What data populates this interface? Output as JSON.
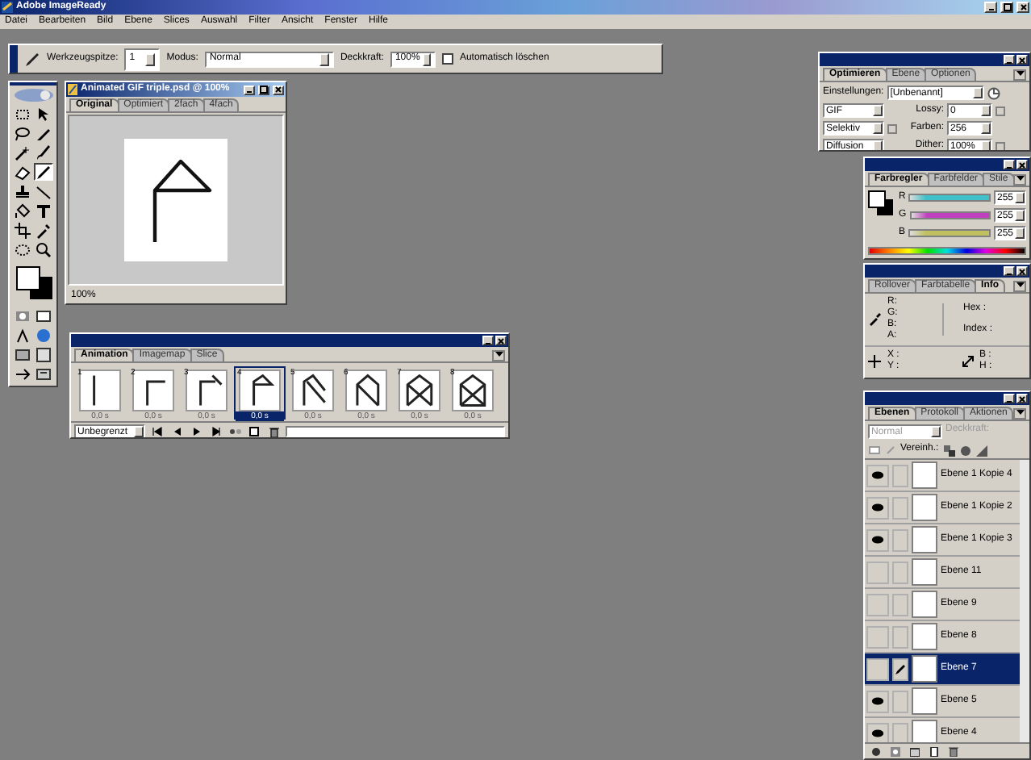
{
  "window": {
    "title": "Adobe ImageReady"
  },
  "menu": [
    "Datei",
    "Bearbeiten",
    "Bild",
    "Ebene",
    "Slices",
    "Auswahl",
    "Filter",
    "Ansicht",
    "Fenster",
    "Hilfe"
  ],
  "options_bar": {
    "brush_label": "Werkzeugspitze:",
    "brush_size": "1",
    "mode_label": "Modus:",
    "mode": "Normal",
    "opacity_label": "Deckkraft:",
    "opacity": "100%",
    "auto_erase": {
      "label": "Automatisch löschen",
      "checked": false
    }
  },
  "tools": [
    {
      "kind": "marquee",
      "selected": false
    },
    {
      "kind": "move",
      "selected": false
    },
    {
      "kind": "lasso",
      "selected": false
    },
    {
      "kind": "slice",
      "selected": false
    },
    {
      "kind": "wand",
      "selected": false
    },
    {
      "kind": "brush",
      "selected": false
    },
    {
      "kind": "eraser",
      "selected": false
    },
    {
      "kind": "pencil",
      "selected": true
    },
    {
      "kind": "stamp",
      "selected": false
    },
    {
      "kind": "line",
      "selected": false
    },
    {
      "kind": "bucket",
      "selected": false
    },
    {
      "kind": "type",
      "selected": false
    },
    {
      "kind": "crop",
      "selected": false
    },
    {
      "kind": "dropper",
      "selected": false
    },
    {
      "kind": "ellipse",
      "selected": false
    },
    {
      "kind": "zoom",
      "selected": false
    }
  ],
  "document": {
    "title": "Animated GIF triple.psd @ 100%",
    "tabs": [
      {
        "label": "Original",
        "selected": true
      },
      {
        "label": "Optimiert",
        "selected": false
      },
      {
        "label": "2fach",
        "selected": false
      },
      {
        "label": "4fach",
        "selected": false
      }
    ],
    "zoom": "100%"
  },
  "animation": {
    "tabs": [
      {
        "label": "Animation",
        "selected": true
      },
      {
        "label": "Imagemap",
        "selected": false
      },
      {
        "label": "Slice",
        "selected": false
      }
    ],
    "frames": [
      {
        "number": "1",
        "delay": "0,0 s",
        "selected": false
      },
      {
        "number": "2",
        "delay": "0,0 s",
        "selected": false
      },
      {
        "number": "3",
        "delay": "0,0 s",
        "selected": false
      },
      {
        "number": "4",
        "delay": "0,0 s",
        "selected": true
      },
      {
        "number": "5",
        "delay": "0,0 s",
        "selected": false
      },
      {
        "number": "6",
        "delay": "0,0 s",
        "selected": false
      },
      {
        "number": "7",
        "delay": "0,0 s",
        "selected": false
      },
      {
        "number": "8",
        "delay": "0,0 s",
        "selected": false
      }
    ],
    "loop": "Unbegrenzt"
  },
  "optimize": {
    "tabs": [
      {
        "label": "Optimieren",
        "selected": true
      },
      {
        "label": "Ebene",
        "selected": false
      },
      {
        "label": "Optionen",
        "selected": false
      }
    ],
    "settings_label": "Einstellungen:",
    "settings": "[Unbenannt]",
    "format": "GIF",
    "lossy_label": "Lossy:",
    "lossy": "0",
    "reduction": "Selektiv",
    "colors_label": "Farben:",
    "colors": "256",
    "dither_method": "Diffusion",
    "dither_label": "Dither:",
    "dither": "100%",
    "checkboxes": [
      {
        "checked": false
      },
      {
        "checked": false
      },
      {
        "checked": false
      }
    ]
  },
  "color": {
    "tabs": [
      {
        "label": "Farbregler",
        "selected": true
      },
      {
        "label": "Farbfelder",
        "selected": false
      },
      {
        "label": "Stile",
        "selected": false
      }
    ],
    "sliders": [
      {
        "label": "R",
        "value": "255",
        "color": "#40c0c8"
      },
      {
        "label": "G",
        "value": "255",
        "color": "#c040c0"
      },
      {
        "label": "B",
        "value": "255",
        "color": "#c0c060"
      }
    ]
  },
  "info": {
    "tabs": [
      {
        "label": "Rollover",
        "selected": false
      },
      {
        "label": "Farbtabelle",
        "selected": false
      },
      {
        "label": "Info",
        "selected": true
      }
    ],
    "color_labels": [
      "R:",
      "G:",
      "B:",
      "A:"
    ],
    "hex_label": "Hex :",
    "index_label": "Index :",
    "position_labels": [
      "X :",
      "Y :"
    ],
    "size_labels": [
      "B :",
      "H :"
    ]
  },
  "layers": {
    "tabs": [
      {
        "label": "Ebenen",
        "selected": true
      },
      {
        "label": "Protokoll",
        "selected": false
      },
      {
        "label": "Aktionen",
        "selected": false
      }
    ],
    "blend": "Normal",
    "opacity_label": "Deckkraft:",
    "unify_label": "Vereinh.:",
    "items": [
      {
        "name": "Ebene 1 Kopie 4",
        "visible": true,
        "selected": false
      },
      {
        "name": "Ebene 1 Kopie 2",
        "visible": true,
        "selected": false
      },
      {
        "name": "Ebene 1 Kopie 3",
        "visible": true,
        "selected": false
      },
      {
        "name": "Ebene 11",
        "visible": false,
        "selected": false
      },
      {
        "name": "Ebene 9",
        "visible": false,
        "selected": false
      },
      {
        "name": "Ebene 8",
        "visible": false,
        "selected": false
      },
      {
        "name": "Ebene 7",
        "visible": false,
        "selected": true
      },
      {
        "name": "Ebene 5",
        "visible": true,
        "selected": false
      },
      {
        "name": "Ebene 4",
        "visible": true,
        "selected": false
      }
    ]
  }
}
